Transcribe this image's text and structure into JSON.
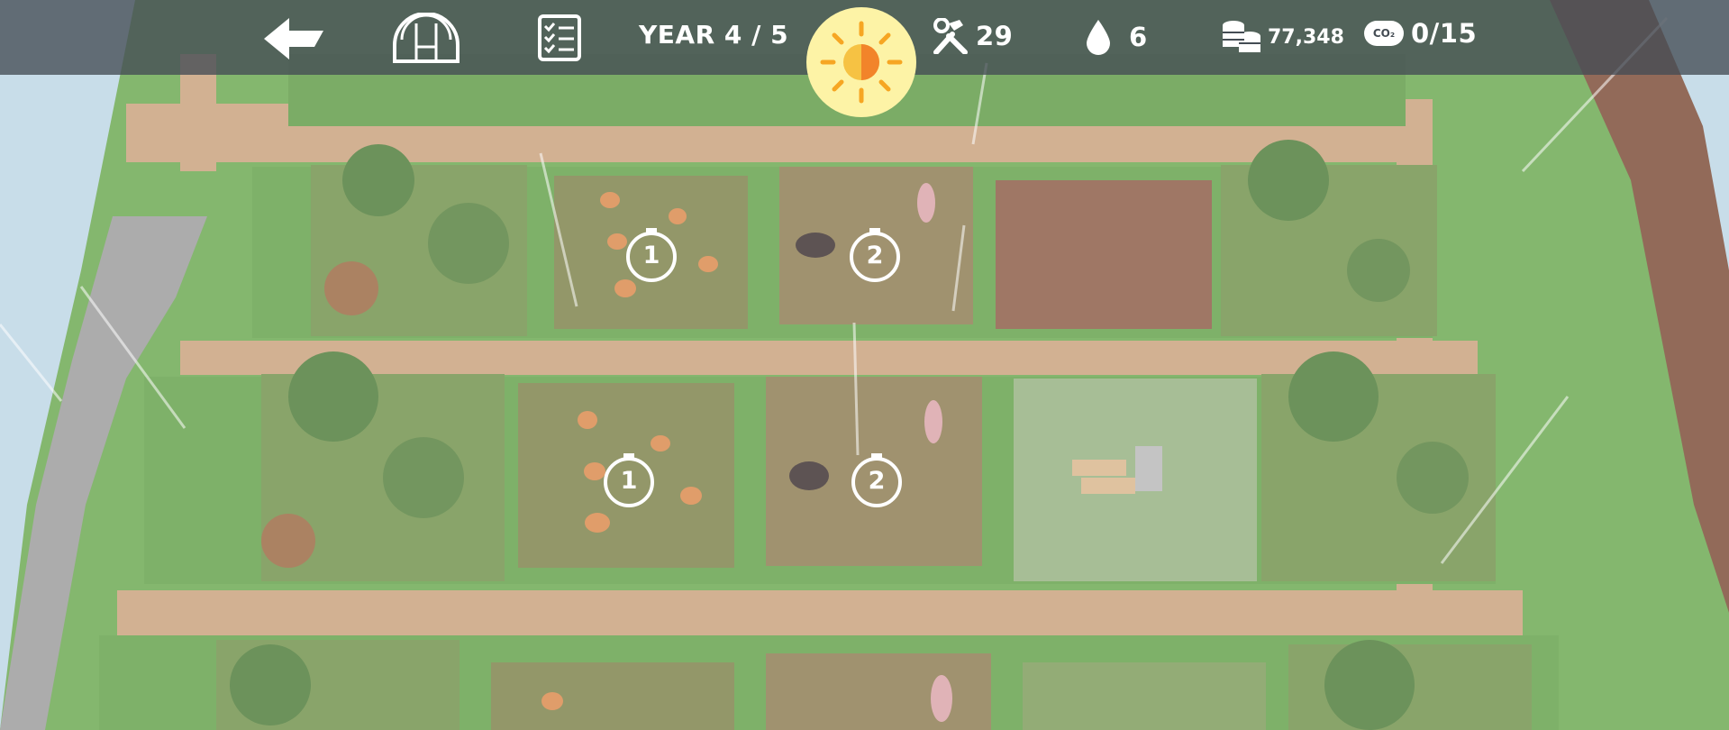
{
  "hud": {
    "year_label": "YEAR 4 / 5",
    "tools_count": "29",
    "water_count": "6",
    "coins_count": "77,348",
    "co2_count": "0/15",
    "co2_icon_text": "CO₂",
    "weather": "sunny"
  },
  "plots": [
    {
      "id": "row1-chickens",
      "timer": "1"
    },
    {
      "id": "row1-pigs",
      "timer": "2"
    },
    {
      "id": "row2-chickens",
      "timer": "1"
    },
    {
      "id": "row2-pigs",
      "timer": "2"
    }
  ],
  "colors": {
    "hud_bar": "#444c54",
    "grass": "#6aa84f",
    "path": "#c9a07a",
    "soil": "#8a5a44",
    "sun_bg": "#fdf3a6",
    "sun": "#f6a623"
  }
}
